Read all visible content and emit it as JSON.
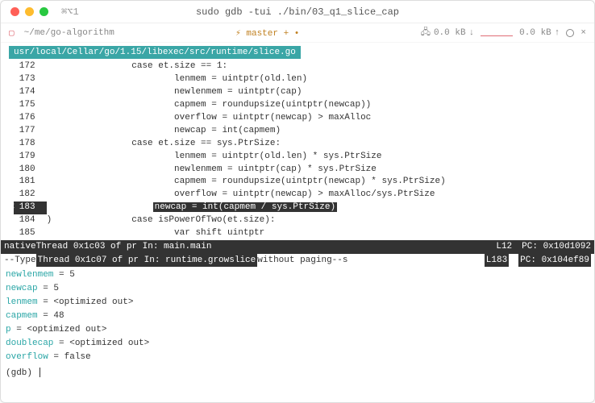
{
  "titlebar": {
    "shortcut": "⌘⌥1",
    "title": "sudo gdb -tui ./bin/03_q1_slice_cap"
  },
  "toolbar": {
    "path": "~/me/go-algorithm",
    "branch": "master + •",
    "down": "0.0 kB",
    "up": "0.0 kB"
  },
  "source": {
    "header": "usr/local/Cellar/go/1.15/libexec/src/runtime/slice.go",
    "lines": [
      {
        "n": "172",
        "t": "            case et.size == 1:"
      },
      {
        "n": "173",
        "t": "                    lenmem = uintptr(old.len)"
      },
      {
        "n": "174",
        "t": "                    newlenmem = uintptr(cap)"
      },
      {
        "n": "175",
        "t": "                    capmem = roundupsize(uintptr(newcap))"
      },
      {
        "n": "176",
        "t": "                    overflow = uintptr(newcap) > maxAlloc"
      },
      {
        "n": "177",
        "t": "                    newcap = int(capmem)"
      },
      {
        "n": "178",
        "t": "            case et.size == sys.PtrSize:"
      },
      {
        "n": "179",
        "t": "                    lenmem = uintptr(old.len) * sys.PtrSize"
      },
      {
        "n": "180",
        "t": "                    newlenmem = uintptr(cap) * sys.PtrSize"
      },
      {
        "n": "181",
        "t": "                    capmem = roundupsize(uintptr(newcap) * sys.PtrSize)"
      },
      {
        "n": "182",
        "t": "                    overflow = uintptr(newcap) > maxAlloc/sys.PtrSize"
      },
      {
        "n": "183",
        "t": "newcap = int(capmem / sys.PtrSize)",
        "current": true,
        "indent": "                    "
      },
      {
        "n": "184",
        "t": "            case isPowerOfTwo(et.size):",
        "cont": ")"
      },
      {
        "n": "185",
        "t": "                    var shift uintptr"
      }
    ]
  },
  "threads": {
    "native_pre": "native ",
    "native_thr": "Thread 0x1c03 of pr In: main.main",
    "native_line": "L12",
    "native_pc": "PC: 0x10d1092",
    "type_pre": "--Type ",
    "type_thr": "Thread 0x1c07 of pr In: runtime.growslice",
    "type_post": "without paging--s",
    "type_line": "L183",
    "type_pc": "PC: 0x104ef89"
  },
  "vars": [
    {
      "name": "newlenmem",
      "val": " = 5"
    },
    {
      "name": "newcap",
      "val": " = 5"
    },
    {
      "name": "lenmem",
      "val": " = <optimized out>"
    },
    {
      "name": "capmem",
      "val": " = 48"
    },
    {
      "name": "p",
      "val": " = <optimized out>"
    },
    {
      "name": "doublecap",
      "val": " = <optimized out>"
    },
    {
      "name": "overflow",
      "val": " = false"
    }
  ],
  "prompt": "(gdb) "
}
